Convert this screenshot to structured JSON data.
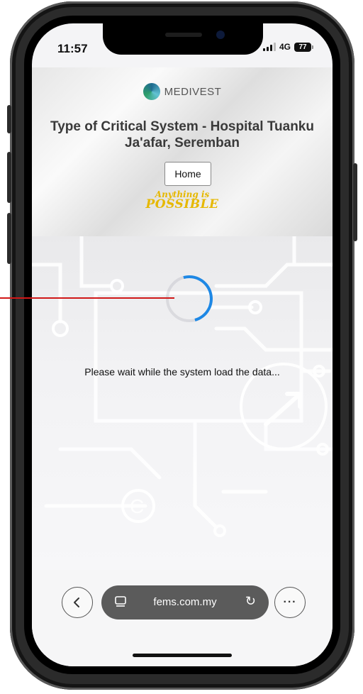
{
  "status": {
    "time": "11:57",
    "network": "4G",
    "battery": "77"
  },
  "logo": {
    "brand": "MEDIVEST"
  },
  "page": {
    "title": "Type of Critical System - Hospital Tuanku Ja'afar, Seremban",
    "home_label": "Home",
    "slogan_line1": "Anything is",
    "slogan_line2": "POSSIBLE",
    "loading_message": "Please wait while the system load the data..."
  },
  "browser": {
    "url": "fems.com.my",
    "back_icon": "chevron-left-icon",
    "tabs_icon": "tabs-icon",
    "reload_icon": "reload-icon",
    "more_icon": "more-icon"
  },
  "colors": {
    "spinner": "#1e88e5",
    "slogan": "#e6b800",
    "annotation_line": "#d01818",
    "url_pill": "#5b5b5b"
  }
}
